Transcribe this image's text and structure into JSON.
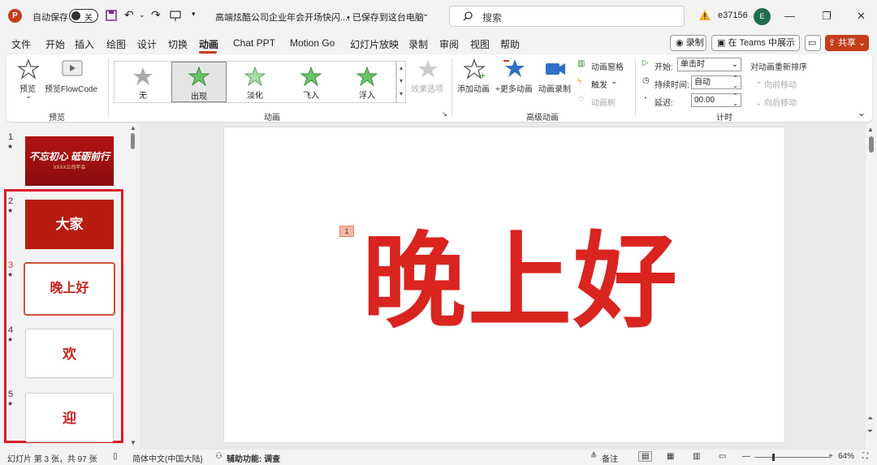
{
  "titlebar": {
    "autosave": "自动保存",
    "toggle": "关",
    "doc_title": "高端炫酷公司企业年会开场快闪....",
    "save_state": "• 已保存到这台电脑",
    "search_placeholder": "搜索",
    "user": "e37156",
    "avatar_initial": "E"
  },
  "menu": [
    "文件",
    "开始",
    "插入",
    "绘图",
    "设计",
    "切换",
    "动画",
    "Chat PPT",
    "Motion Go",
    "幻灯片放映",
    "录制",
    "审阅",
    "视图",
    "帮助"
  ],
  "menu_active": "动画",
  "buttons": {
    "record": "录制",
    "teams": "在 Teams 中展示",
    "share": "共享"
  },
  "ribbon": {
    "preview": "预览",
    "preview_flowcode": "预览FlowCode",
    "group_preview": "预览",
    "gallery": [
      "无",
      "出现",
      "淡化",
      "飞入",
      "浮入"
    ],
    "effect_options": "效果选项",
    "group_animation": "动画",
    "add_animation": "添加动画",
    "more_animation": "+更多动画",
    "anim_record": "动画录制",
    "anim_pane": "动画窗格",
    "trigger": "触发",
    "anim_painter": "动画刷",
    "group_advanced": "高级动画",
    "start_label": "开始:",
    "start_value": "单击时",
    "duration_label": "持续时间:",
    "duration_value": "自动",
    "delay_label": "延迟:",
    "delay_value": "00.00",
    "reorder": "对动画重新排序",
    "move_earlier": "向前移动",
    "move_later": "向后移动",
    "group_timing": "计时"
  },
  "slides": [
    {
      "num": "1",
      "text": "不忘初心 砥砺前行",
      "sub": "XXXX公司年会"
    },
    {
      "num": "2",
      "text": "大家"
    },
    {
      "num": "3",
      "text": "晚上好"
    },
    {
      "num": "4",
      "text": "欢"
    },
    {
      "num": "5",
      "text": "迎"
    }
  ],
  "canvas": {
    "main_text": "晚上好",
    "anim_tag": "1"
  },
  "status": {
    "slide_info": "幻灯片 第 3 张，共 97 张",
    "language": "简体中文(中国大陆)",
    "accessibility": "辅助功能: 调查",
    "notes": "备注",
    "zoom": "64%"
  },
  "colors": {
    "accent": "#c43e1c",
    "slide_red": "#d92420",
    "highlight_box": "#d92027"
  }
}
